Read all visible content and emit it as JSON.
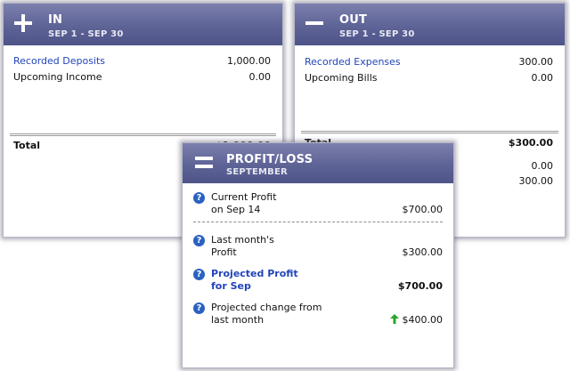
{
  "in_card": {
    "title": "IN",
    "period": "SEP 1 - SEP 30",
    "rows": [
      {
        "label": "Recorded Deposits",
        "value": "1,000.00"
      },
      {
        "label": "Upcoming Income",
        "value": "0.00"
      }
    ],
    "total_label": "Total",
    "total_value": "$1,000.00"
  },
  "out_card": {
    "title": "OUT",
    "period": "SEP 1 - SEP 30",
    "rows": [
      {
        "label": "Recorded Expenses",
        "value": "300.00"
      },
      {
        "label": "Upcoming Bills",
        "value": "0.00"
      }
    ],
    "total_label": "Total",
    "total_value": "$300.00",
    "extra_values": [
      "0.00",
      "300.00"
    ]
  },
  "pl_card": {
    "title": "PROFIT/LOSS",
    "subtitle": "SEPTEMBER",
    "items": [
      {
        "line1": "Current Profit",
        "line2": "on Sep 14",
        "value": "$700.00"
      },
      {
        "line1": "Last month's",
        "line2": "Profit",
        "value": "$300.00"
      },
      {
        "line1": "Projected Profit",
        "line2": "for Sep",
        "value": "$700.00"
      },
      {
        "line1": "Projected change from",
        "line2": "last month",
        "value": "$400.00"
      }
    ],
    "help_glyph": "?",
    "trend": "up"
  },
  "colors": {
    "header": "#5e6396",
    "link": "#2244bb",
    "help_icon": "#2a61c2",
    "trend_up": "#2aa52a"
  }
}
